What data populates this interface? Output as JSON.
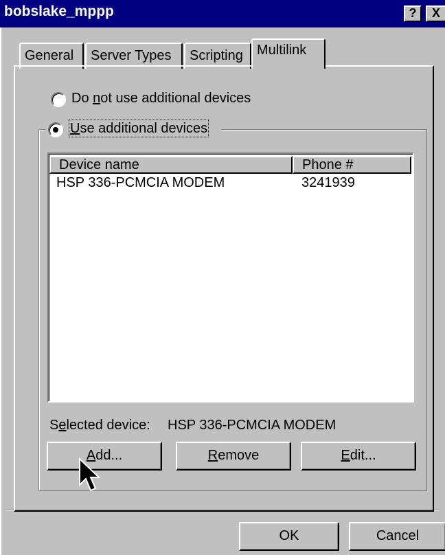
{
  "window": {
    "title": "bobslake_mppp",
    "help_button": "?",
    "close_button": "X"
  },
  "tabs": [
    {
      "label": "General",
      "active": false
    },
    {
      "label": "Server Types",
      "active": false
    },
    {
      "label": "Scripting",
      "active": false
    },
    {
      "label": "Multilink",
      "active": true
    }
  ],
  "options": {
    "no_devices": {
      "before": "Do ",
      "mnemonic": "n",
      "after": "ot use additional devices",
      "selected": false
    },
    "use_devices": {
      "before": "",
      "mnemonic": "U",
      "after": "se additional devices",
      "selected": true
    }
  },
  "device_list": {
    "columns": [
      "Device name",
      "Phone #"
    ],
    "rows": [
      {
        "device": "HSP 336-PCMCIA MODEM",
        "phone": "3241939"
      }
    ]
  },
  "selected_device": {
    "label_before": "S",
    "label_mnemonic": "e",
    "label_after": "lected device:",
    "value": "HSP 336-PCMCIA MODEM"
  },
  "buttons": {
    "add": {
      "before": "",
      "mnemonic": "A",
      "after": "dd..."
    },
    "remove": {
      "before": "",
      "mnemonic": "R",
      "after": "emove"
    },
    "edit": {
      "before": "",
      "mnemonic": "E",
      "after": "dit..."
    },
    "ok": "OK",
    "cancel": "Cancel"
  }
}
